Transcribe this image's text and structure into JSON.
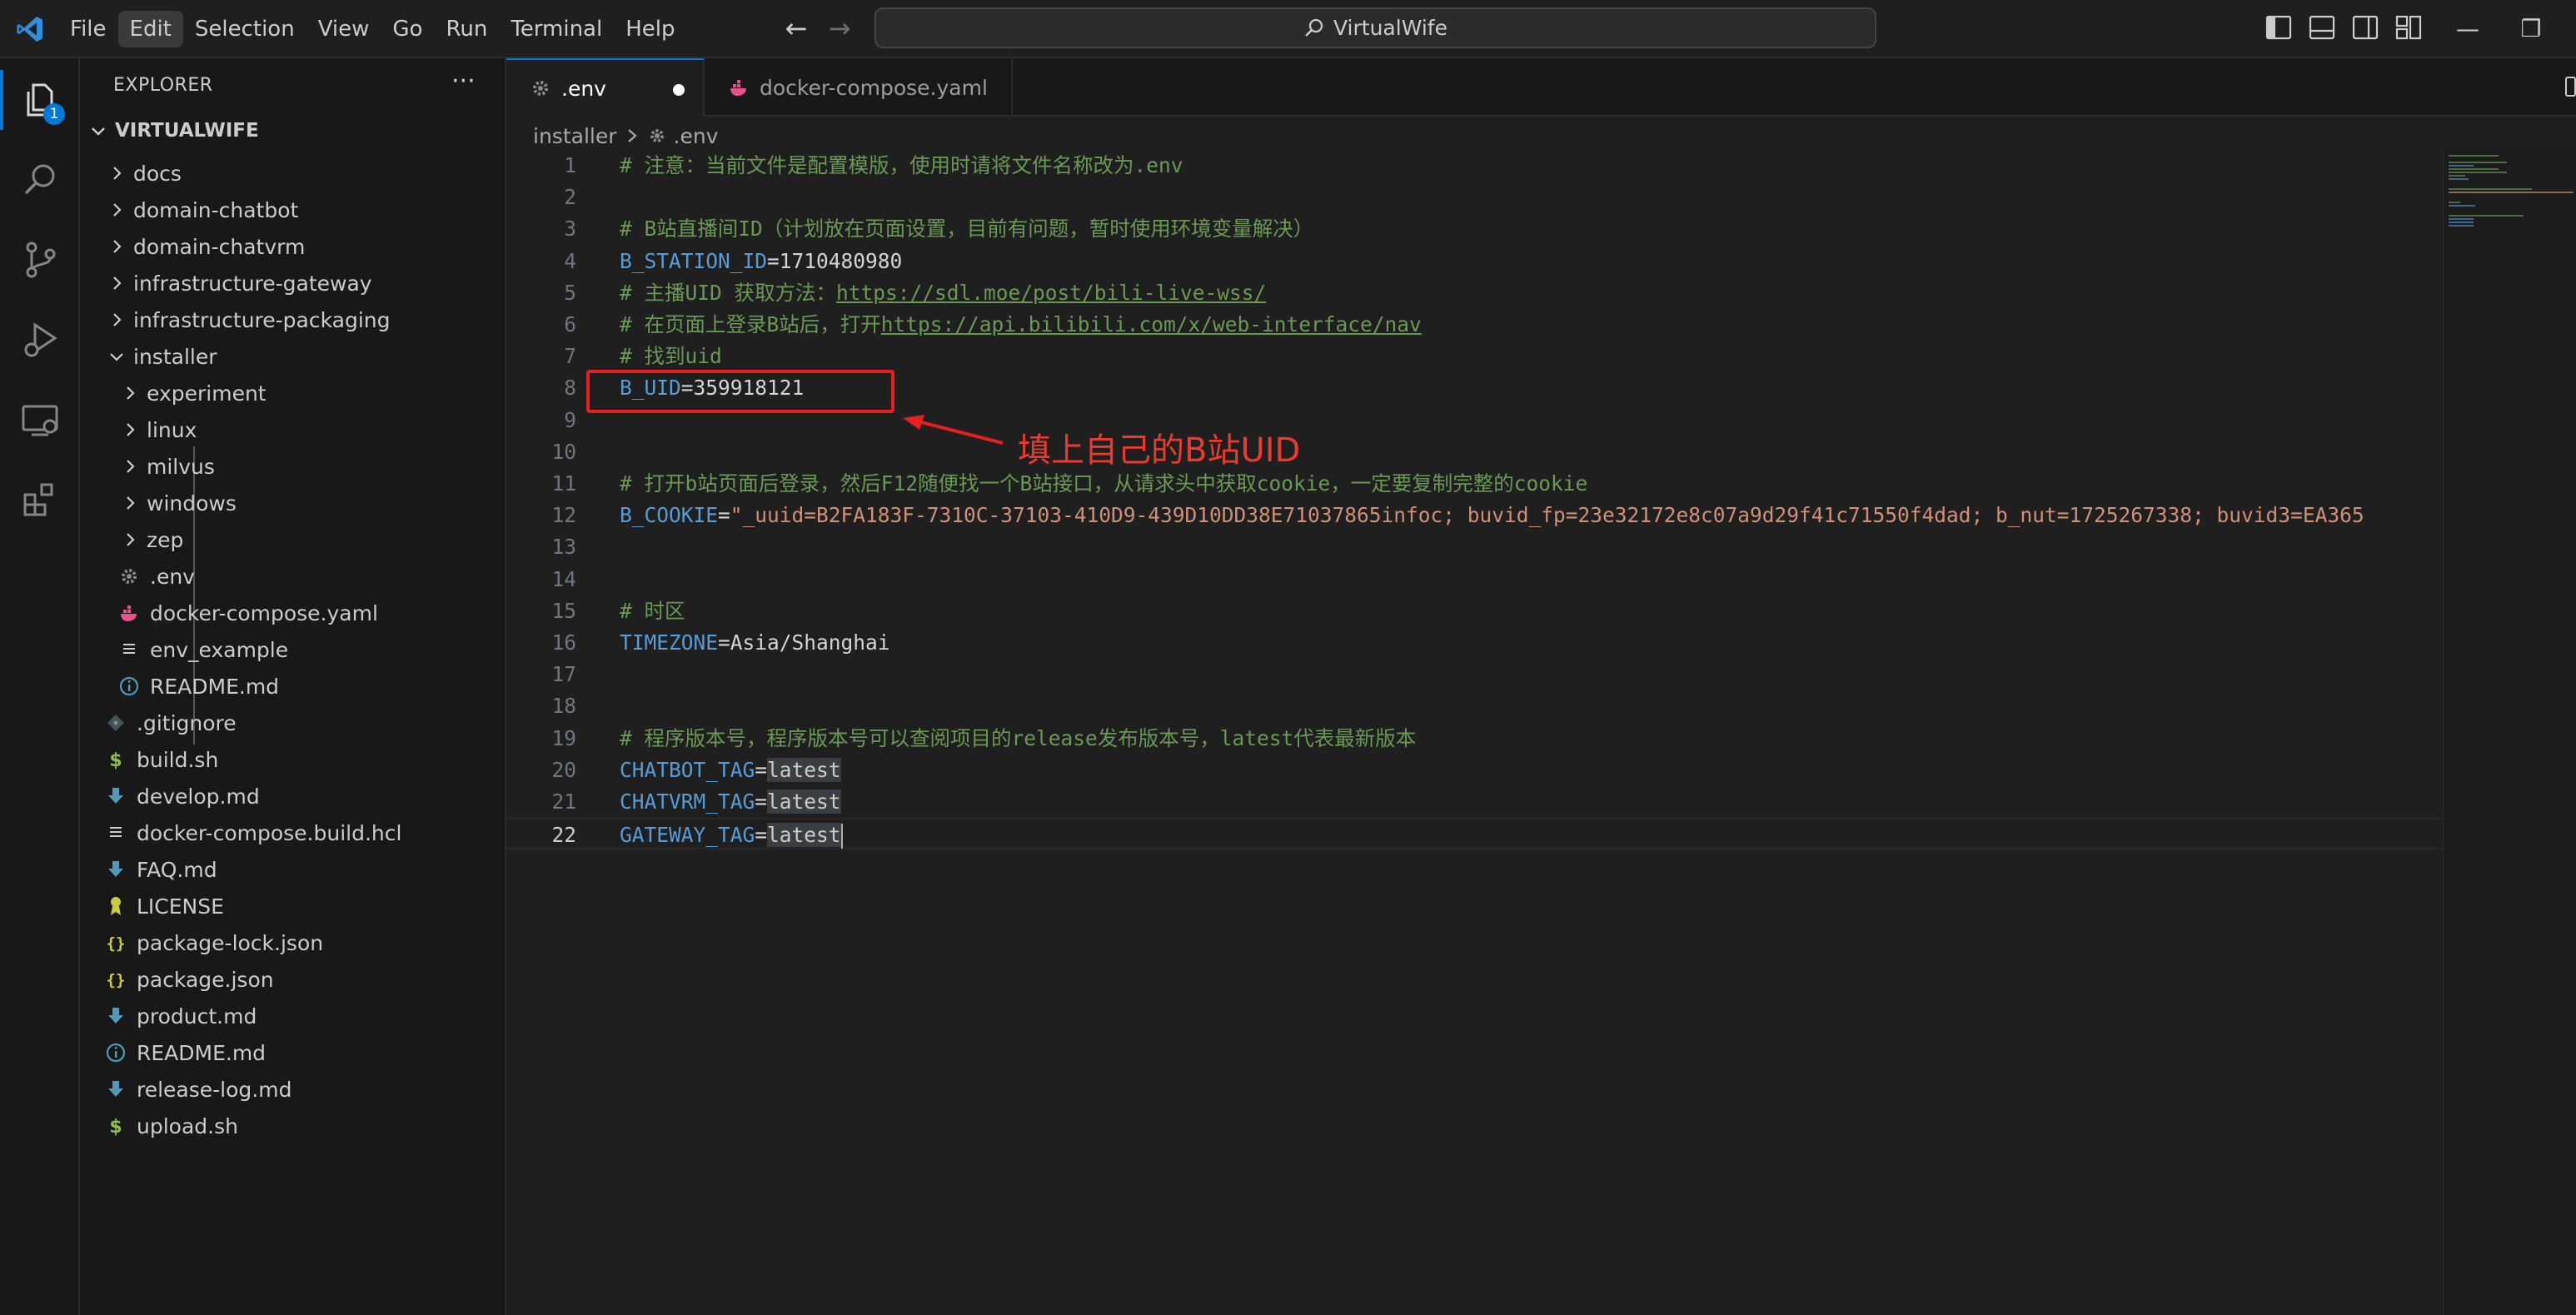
{
  "menu": {
    "items": [
      "File",
      "Edit",
      "Selection",
      "View",
      "Go",
      "Run",
      "Terminal",
      "Help"
    ],
    "active_index": 1
  },
  "command_center": {
    "text": "VirtualWife"
  },
  "activity_bar": {
    "explorer_badge": "1"
  },
  "sidebar": {
    "header": "EXPLORER",
    "more": "···",
    "root": "VIRTUALWIFE",
    "items": [
      {
        "label": "docs",
        "type": "folder",
        "icon": "chevron-right-icon"
      },
      {
        "label": "domain-chatbot",
        "type": "folder",
        "icon": "chevron-right-icon"
      },
      {
        "label": "domain-chatvrm",
        "type": "folder",
        "icon": "chevron-right-icon"
      },
      {
        "label": "infrastructure-gateway",
        "type": "folder",
        "icon": "chevron-right-icon"
      },
      {
        "label": "infrastructure-packaging",
        "type": "folder",
        "icon": "chevron-right-icon"
      },
      {
        "label": "installer",
        "type": "folder-open",
        "icon": "chevron-down-icon"
      },
      {
        "label": "experiment",
        "type": "folder",
        "icon": "chevron-right-icon"
      },
      {
        "label": "linux",
        "type": "folder",
        "icon": "chevron-right-icon"
      },
      {
        "label": "milvus",
        "type": "folder",
        "icon": "chevron-right-icon"
      },
      {
        "label": "windows",
        "type": "folder",
        "icon": "chevron-right-icon"
      },
      {
        "label": "zep",
        "type": "folder",
        "icon": "chevron-right-icon"
      },
      {
        "label": ".env",
        "type": "file",
        "icon": "gear-icon"
      },
      {
        "label": "docker-compose.yaml",
        "type": "file",
        "icon": "docker-icon"
      },
      {
        "label": "env_example",
        "type": "file",
        "icon": "lines-icon"
      },
      {
        "label": "README.md",
        "type": "file",
        "icon": "info-icon"
      },
      {
        "label": ".gitignore",
        "type": "file",
        "icon": "git-icon"
      },
      {
        "label": "build.sh",
        "type": "file",
        "icon": "dollar-icon"
      },
      {
        "label": "develop.md",
        "type": "file",
        "icon": "markdown-icon"
      },
      {
        "label": "docker-compose.build.hcl",
        "type": "file",
        "icon": "lines-icon"
      },
      {
        "label": "FAQ.md",
        "type": "file",
        "icon": "markdown-icon"
      },
      {
        "label": "LICENSE",
        "type": "file",
        "icon": "license-icon"
      },
      {
        "label": "package-lock.json",
        "type": "file",
        "icon": "braces-icon"
      },
      {
        "label": "package.json",
        "type": "file",
        "icon": "braces-icon"
      },
      {
        "label": "product.md",
        "type": "file",
        "icon": "markdown-icon"
      },
      {
        "label": "README.md",
        "type": "file",
        "icon": "info-icon"
      },
      {
        "label": "release-log.md",
        "type": "file",
        "icon": "markdown-icon"
      },
      {
        "label": "upload.sh",
        "type": "file",
        "icon": "dollar-icon"
      }
    ]
  },
  "tabs": [
    {
      "label": ".env",
      "active": true,
      "modified": true
    },
    {
      "label": "docker-compose.yaml",
      "active": false,
      "modified": false
    }
  ],
  "breadcrumb": [
    "installer",
    ".env"
  ],
  "editor": {
    "current_line": 22,
    "lines": [
      {
        "n": "1",
        "parts": [
          {
            "t": "# 注意：当前文件是配置模版，使用时请将文件名称改为.env",
            "c": "comment"
          }
        ]
      },
      {
        "n": "2",
        "parts": []
      },
      {
        "n": "3",
        "parts": [
          {
            "t": "# B站直播间ID（计划放在页面设置，目前有问题，暂时使用环境变量解决）",
            "c": "comment"
          }
        ]
      },
      {
        "n": "4",
        "parts": [
          {
            "t": "B_STATION_ID",
            "c": "key"
          },
          {
            "t": "=",
            "c": "op"
          },
          {
            "t": "1710480980",
            "c": "val"
          }
        ]
      },
      {
        "n": "5",
        "parts": [
          {
            "t": "# 主播UID 获取方法：",
            "c": "comment"
          },
          {
            "t": "https://sdl.moe/post/bili-live-wss/",
            "c": "link"
          }
        ]
      },
      {
        "n": "6",
        "parts": [
          {
            "t": "# 在页面上登录B站后，打开",
            "c": "comment"
          },
          {
            "t": "https://api.bilibili.com/x/web-interface/nav",
            "c": "link"
          }
        ]
      },
      {
        "n": "7",
        "parts": [
          {
            "t": "# 找到uid",
            "c": "comment"
          }
        ]
      },
      {
        "n": "8",
        "parts": [
          {
            "t": "B_UID",
            "c": "key"
          },
          {
            "t": "=",
            "c": "op"
          },
          {
            "t": "359918121",
            "c": "val"
          }
        ]
      },
      {
        "n": "9",
        "parts": []
      },
      {
        "n": "10",
        "parts": []
      },
      {
        "n": "11",
        "parts": [
          {
            "t": "# 打开b站页面后登录，然后F12随便找一个B站接口，从请求头中获取cookie，一定要复制完整的cookie",
            "c": "comment"
          }
        ]
      },
      {
        "n": "12",
        "parts": [
          {
            "t": "B_COOKIE",
            "c": "key"
          },
          {
            "t": "=",
            "c": "op"
          },
          {
            "t": "\"_uuid=B2FA183F-7310C-37103-410D9-439D10DD38E71037865infoc; buvid_fp=23e32172e8c07a9d29f41c71550f4dad; b_nut=1725267338; buvid3=EA365",
            "c": "str"
          }
        ]
      },
      {
        "n": "13",
        "parts": []
      },
      {
        "n": "14",
        "parts": []
      },
      {
        "n": "15",
        "parts": [
          {
            "t": "# 时区",
            "c": "comment"
          }
        ]
      },
      {
        "n": "16",
        "parts": [
          {
            "t": "TIMEZONE",
            "c": "key"
          },
          {
            "t": "=",
            "c": "op"
          },
          {
            "t": "Asia/Shanghai",
            "c": "val"
          }
        ]
      },
      {
        "n": "17",
        "parts": []
      },
      {
        "n": "18",
        "parts": []
      },
      {
        "n": "19",
        "parts": [
          {
            "t": "# 程序版本号，程序版本号可以查阅项目的release发布版本号，latest代表最新版本",
            "c": "comment"
          }
        ]
      },
      {
        "n": "20",
        "parts": [
          {
            "t": "CHATBOT_TAG",
            "c": "key"
          },
          {
            "t": "=",
            "c": "op"
          },
          {
            "t": "latest",
            "c": "sel"
          }
        ]
      },
      {
        "n": "21",
        "parts": [
          {
            "t": "CHATVRM_TAG",
            "c": "key"
          },
          {
            "t": "=",
            "c": "op"
          },
          {
            "t": "latest",
            "c": "sel"
          }
        ]
      },
      {
        "n": "22",
        "parts": [
          {
            "t": "GATEWAY_TAG",
            "c": "key"
          },
          {
            "t": "=",
            "c": "op"
          },
          {
            "t": "latest",
            "c": "sel"
          }
        ]
      }
    ]
  },
  "annotation": {
    "text": "填上自己的B站UID",
    "color": "#ea3b2e"
  },
  "colors": {
    "accent": "#0078d4",
    "comment": "#6a9955",
    "key": "#569cd6",
    "string": "#ce9178"
  }
}
